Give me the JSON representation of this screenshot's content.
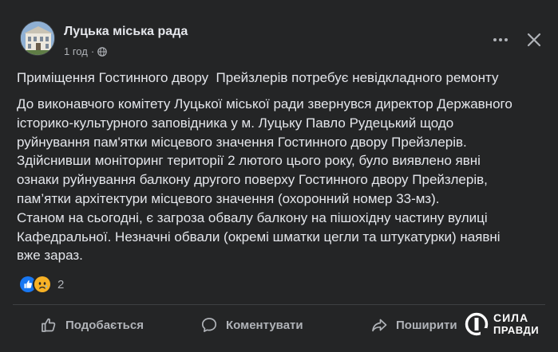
{
  "post": {
    "page_name": "Луцька міська рада",
    "time": "1 год",
    "separator": "·",
    "privacy_icon": "globe-icon",
    "headline": "Приміщення Гостинного двору  Прейзлерів потребує невідкладного ремонту",
    "body_lines": [
      "До виконавчого комітету Луцької міської ради звернувся директор Державного",
      "історико-культурного заповідника у м. Луцьку Павло Рудецький щодо",
      "руйнування пам'ятки місцевого значення Гостинного двору Прейзлерів.",
      "Здійснивши моніторинг території 2 лютого цього року, було виявлено явні",
      "ознаки руйнування балкону другого поверху Гостинного двору Прейзлерів,",
      "пам’ятки архітектури місцевого значення (охоронний номер 33-мз).",
      "Станом на сьогодні, є загроза обвалу балкону на пішохідну частину вулиці",
      "Кафедральної. Незначні обвали (окремі шматки цегли та штукатурки) наявні",
      "вже зараз."
    ],
    "reactions": {
      "icons": [
        "like-reaction-icon",
        "sad-reaction-icon"
      ],
      "count": "2"
    }
  },
  "actions": {
    "like_label": "Подобається",
    "comment_label": "Коментувати",
    "share_label": "Поширити"
  },
  "watermark": {
    "line1": "СИЛА",
    "line2": "ПРАВДИ"
  },
  "colors": {
    "card_bg": "#242526",
    "text_primary": "#e4e6eb",
    "text_secondary": "#b0b3b8",
    "like_blue": "#1877f2",
    "sad_yellow": "#f7b125"
  }
}
